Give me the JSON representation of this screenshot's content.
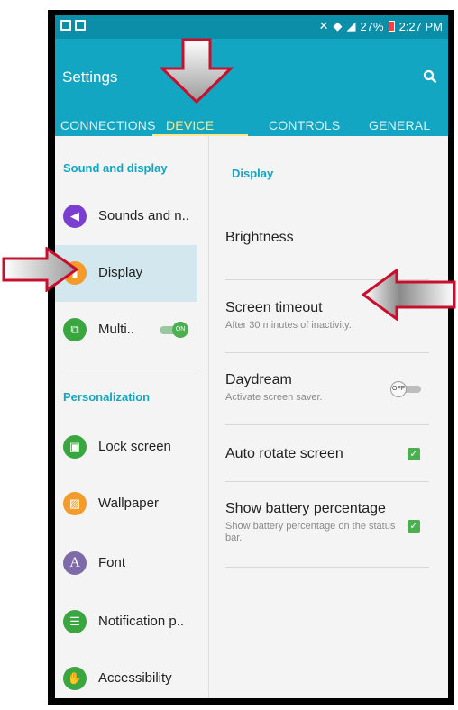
{
  "status_bar": {
    "battery": "27%",
    "time": "2:27 PM"
  },
  "header": {
    "title": "Settings",
    "tabs": [
      {
        "label": "CONNECTIONS"
      },
      {
        "label": "DEVICE"
      },
      {
        "label": "CONTROLS"
      },
      {
        "label": "GENERAL"
      }
    ],
    "active_tab": "DEVICE"
  },
  "sidebar": {
    "sections": [
      {
        "title": "Sound and display"
      },
      {
        "title": "Personalization"
      }
    ],
    "items": [
      {
        "label": "Sounds and n..",
        "icon": "volume-icon",
        "color": "#7b3fd0"
      },
      {
        "label": "Display",
        "icon": "display-icon",
        "color": "#f39c2b"
      },
      {
        "label": "Multi..",
        "icon": "multi-window-icon",
        "color": "#3aa63f",
        "toggle": "ON"
      },
      {
        "label": "Lock screen",
        "icon": "lock-screen-icon",
        "color": "#3aa63f"
      },
      {
        "label": "Wallpaper",
        "icon": "wallpaper-icon",
        "color": "#f39c2b"
      },
      {
        "label": "Font",
        "icon": "font-icon",
        "color": "#7e6aa8",
        "glyph": "A"
      },
      {
        "label": "Notification p..",
        "icon": "notification-panel-icon",
        "color": "#3aa63f"
      },
      {
        "label": "Accessibility",
        "icon": "accessibility-icon",
        "color": "#3aa63f"
      }
    ]
  },
  "main": {
    "section_title": "Display",
    "items": [
      {
        "title": "Brightness"
      },
      {
        "title": "Screen timeout",
        "subtitle": "After 30 minutes of inactivity."
      },
      {
        "title": "Daydream",
        "subtitle": "Activate screen saver.",
        "toggle": "OFF"
      },
      {
        "title": "Auto rotate screen",
        "checked": true
      },
      {
        "title": "Show battery percentage",
        "subtitle": "Show battery percentage on the status bar.",
        "checked": true
      }
    ]
  },
  "colors": {
    "accent": "#12a6c2",
    "tab_active": "#ffe98a",
    "arrow": "#c8102e"
  }
}
